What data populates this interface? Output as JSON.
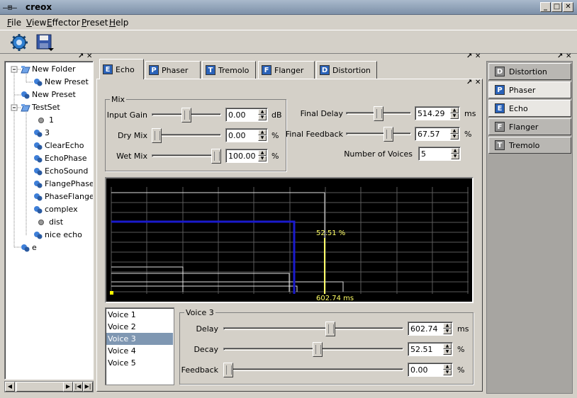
{
  "window": {
    "app_icon": "—⊞—",
    "title": "creox",
    "min": "_",
    "max": "□",
    "close": "✕"
  },
  "menu": [
    "File",
    "View",
    "Effector",
    "Preset",
    "Help"
  ],
  "toolbar": {
    "icons": [
      "gear-icon",
      "save-icon"
    ]
  },
  "dock_controls": {
    "float": "↗",
    "close": "✕"
  },
  "tree": {
    "items": [
      {
        "label": "New Folder",
        "depth": 0
      },
      {
        "label": "New Preset",
        "depth": 1
      },
      {
        "label": "New Preset",
        "depth": 0
      },
      {
        "label": "TestSet",
        "depth": 0
      },
      {
        "label": "1",
        "depth": 1
      },
      {
        "label": "3",
        "depth": 1
      },
      {
        "label": "ClearEcho",
        "depth": 1
      },
      {
        "label": "EchoPhase",
        "depth": 1
      },
      {
        "label": "EchoSound",
        "depth": 1
      },
      {
        "label": "FlangePhase",
        "depth": 1
      },
      {
        "label": "PhaseFlange",
        "depth": 1
      },
      {
        "label": "complex",
        "depth": 1
      },
      {
        "label": "dist",
        "depth": 1
      },
      {
        "label": "nice echo",
        "depth": 1
      },
      {
        "label": "e",
        "depth": 0
      }
    ]
  },
  "scroll": {
    "left": "◀",
    "right": "▶",
    "next": "▶|",
    "prev": "|◀"
  },
  "tabs": [
    {
      "label": "Echo",
      "icon": "E",
      "active": true
    },
    {
      "label": "Phaser",
      "icon": "P",
      "active": false
    },
    {
      "label": "Tremolo",
      "icon": "T",
      "active": false
    },
    {
      "label": "Flanger",
      "icon": "F",
      "active": false
    },
    {
      "label": "Distortion",
      "icon": "D",
      "active": false
    }
  ],
  "mix": {
    "title": "Mix",
    "input_gain": {
      "label": "Input Gain",
      "value": "0.00",
      "unit": "dB",
      "level": 0.5
    },
    "dry_mix": {
      "label": "Dry Mix",
      "value": "0.00",
      "unit": "%",
      "level": 0.0
    },
    "wet_mix": {
      "label": "Wet Mix",
      "value": "100.00",
      "unit": "%",
      "level": 1.0
    }
  },
  "final": {
    "delay": {
      "label": "Final Delay",
      "value": "514.29",
      "unit": "ms",
      "level": 0.5
    },
    "feedback": {
      "label": "Final Feedback",
      "value": "67.57",
      "unit": "%",
      "level": 0.6757
    },
    "voices": {
      "label": "Number of Voices",
      "value": "5"
    }
  },
  "graph": {
    "amplitude_label": "52.51 %",
    "delay_label": "602.74 ms"
  },
  "voices": [
    "Voice 1",
    "Voice 2",
    "Voice 3",
    "Voice 4",
    "Voice 5"
  ],
  "selected_voice": 2,
  "voice": {
    "title": "Voice 3",
    "delay": {
      "label": "Delay",
      "value": "602.74",
      "unit": "ms",
      "level": 0.6
    },
    "decay": {
      "label": "Decay",
      "value": "52.51",
      "unit": "%",
      "level": 0.5251
    },
    "feedback": {
      "label": "Feedback",
      "value": "0.00",
      "unit": "%",
      "level": 0.0
    }
  },
  "right_dock": [
    {
      "label": "Distortion",
      "icon": "D",
      "enabled": false
    },
    {
      "label": "Phaser",
      "icon": "P",
      "enabled": true
    },
    {
      "label": "Echo",
      "icon": "E",
      "enabled": true
    },
    {
      "label": "Flanger",
      "icon": "F",
      "enabled": false
    },
    {
      "label": "Tremolo",
      "icon": "T",
      "enabled": false
    }
  ]
}
